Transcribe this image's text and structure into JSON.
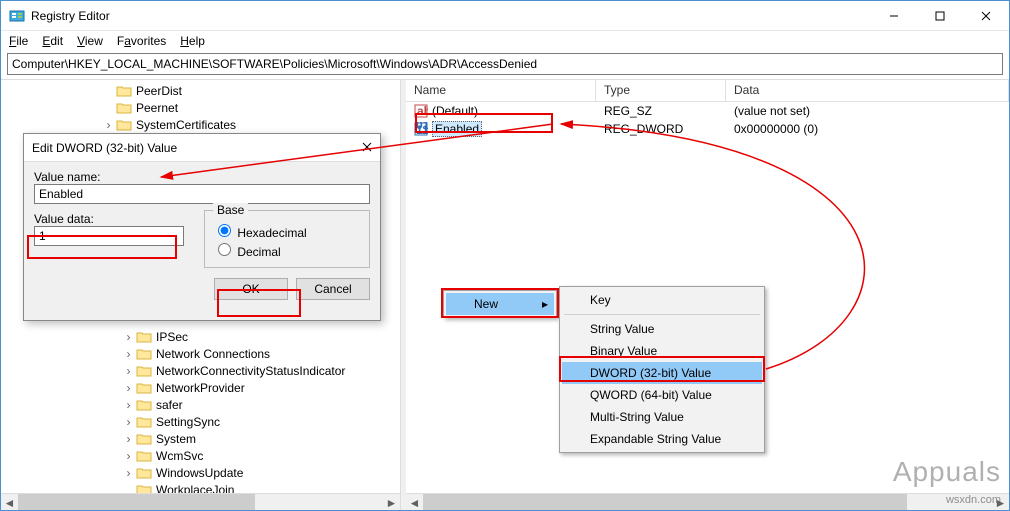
{
  "window": {
    "title": "Registry Editor"
  },
  "menu": {
    "file": "File",
    "edit": "Edit",
    "view": "View",
    "favorites": "Favorites",
    "help": "Help"
  },
  "address": "Computer\\HKEY_LOCAL_MACHINE\\SOFTWARE\\Policies\\Microsoft\\Windows\\ADR\\AccessDenied",
  "tree_top": [
    {
      "label": "PeerDist",
      "indent": 100,
      "exp": ""
    },
    {
      "label": "Peernet",
      "indent": 100,
      "exp": ""
    },
    {
      "label": "SystemCertificates",
      "indent": 100,
      "exp": ">"
    }
  ],
  "tree_bottom": [
    {
      "label": "IPSec",
      "indent": 120,
      "exp": ">"
    },
    {
      "label": "Network Connections",
      "indent": 120,
      "exp": ">"
    },
    {
      "label": "NetworkConnectivityStatusIndicator",
      "indent": 120,
      "exp": ">"
    },
    {
      "label": "NetworkProvider",
      "indent": 120,
      "exp": ">"
    },
    {
      "label": "safer",
      "indent": 120,
      "exp": ">"
    },
    {
      "label": "SettingSync",
      "indent": 120,
      "exp": ">"
    },
    {
      "label": "System",
      "indent": 120,
      "exp": ">"
    },
    {
      "label": "WcmSvc",
      "indent": 120,
      "exp": ">"
    },
    {
      "label": "WindowsUpdate",
      "indent": 120,
      "exp": ">"
    },
    {
      "label": "WorkplaceJoin",
      "indent": 120,
      "exp": ""
    }
  ],
  "list": {
    "headers": {
      "name": "Name",
      "type": "Type",
      "data": "Data"
    },
    "rows": [
      {
        "icon": "string",
        "name": "(Default)",
        "type": "REG_SZ",
        "data": "(value not set)",
        "selected": false
      },
      {
        "icon": "dword",
        "name": "Enabled",
        "type": "REG_DWORD",
        "data": "0x00000000 (0)",
        "selected": true
      }
    ]
  },
  "dialog": {
    "title": "Edit DWORD (32-bit) Value",
    "label_name": "Value name:",
    "value_name": "Enabled",
    "label_data": "Value data:",
    "value_data": "1",
    "base_legend": "Base",
    "opt_hex": "Hexadecimal",
    "opt_dec": "Decimal",
    "ok": "OK",
    "cancel": "Cancel"
  },
  "ctx_new": {
    "label": "New"
  },
  "ctx_sub": {
    "items": [
      {
        "label": "Key",
        "sep_after": true
      },
      {
        "label": "String Value"
      },
      {
        "label": "Binary Value"
      },
      {
        "label": "DWORD (32-bit) Value",
        "selected": true
      },
      {
        "label": "QWORD (64-bit) Value"
      },
      {
        "label": "Multi-String Value"
      },
      {
        "label": "Expandable String Value"
      }
    ]
  },
  "watermark": "Appuals",
  "watermark2": "wsxdn.com"
}
